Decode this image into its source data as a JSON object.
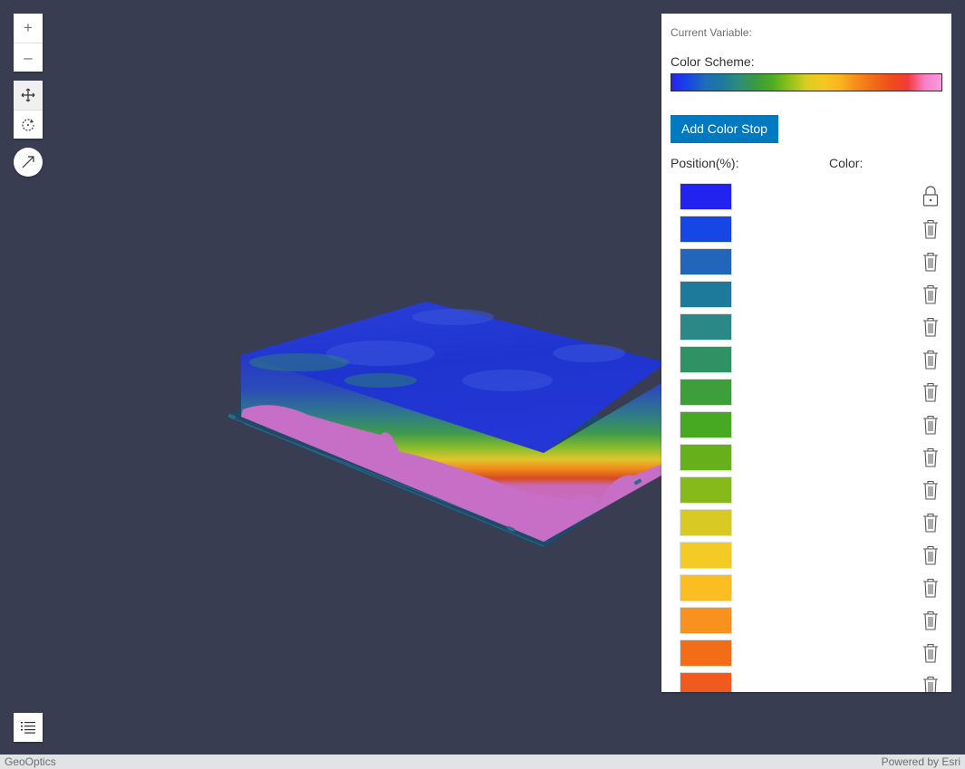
{
  "zoom": {
    "in_label": "+",
    "out_label": "–"
  },
  "navigation": {
    "pan_icon": "pan-icon",
    "rotate_icon": "rotate-icon",
    "active": "pan"
  },
  "compass": {
    "icon": "compass-arrow-icon"
  },
  "legend": {
    "icon": "list-icon"
  },
  "panel": {
    "current_variable_label": "Current Variable:",
    "color_scheme_label": "Color Scheme:",
    "add_button_label": "Add Color Stop",
    "position_header": "Position(%):",
    "color_header": "Color:",
    "scheme_colors": [
      "#2323f0",
      "#1746e6",
      "#1f6cb8",
      "#1d7a9b",
      "#2f8c7a",
      "#3a9a40",
      "#50ad21",
      "#8fc21b",
      "#d9cd24",
      "#f5c821",
      "#fab41e",
      "#f68a1c",
      "#f26b17",
      "#f04c1c",
      "#f33a3a",
      "#f67fc7",
      "#f99de0"
    ],
    "stops": [
      {
        "color": "#2323f0",
        "icon": "lock-icon"
      },
      {
        "color": "#1746e6",
        "icon": "trash-icon"
      },
      {
        "color": "#2266bb",
        "icon": "trash-icon"
      },
      {
        "color": "#1d7a9b",
        "icon": "trash-icon"
      },
      {
        "color": "#2a8887",
        "icon": "trash-icon"
      },
      {
        "color": "#2e9264",
        "icon": "trash-icon"
      },
      {
        "color": "#3c9f3a",
        "icon": "trash-icon"
      },
      {
        "color": "#46a921",
        "icon": "trash-icon"
      },
      {
        "color": "#66b11b",
        "icon": "trash-icon"
      },
      {
        "color": "#86ba1b",
        "icon": "trash-icon"
      },
      {
        "color": "#d8c925",
        "icon": "trash-icon"
      },
      {
        "color": "#f4cb24",
        "icon": "trash-icon"
      },
      {
        "color": "#fbbd22",
        "icon": "trash-icon"
      },
      {
        "color": "#f8911e",
        "icon": "trash-icon"
      },
      {
        "color": "#f36d19",
        "icon": "trash-icon"
      },
      {
        "color": "#f05a1d",
        "icon": "trash-icon"
      }
    ]
  },
  "footer": {
    "left_text": "GeoOptics",
    "right_text": "Powered by Esri"
  }
}
